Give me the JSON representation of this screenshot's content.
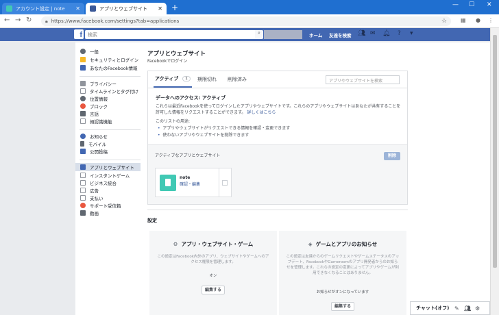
{
  "browser": {
    "tabs": [
      {
        "title": "アカウント設定 | note",
        "favicon_color": "#41c9b4"
      },
      {
        "title": "アプリとウェブサイト",
        "favicon_color": "#3b5998"
      }
    ],
    "new_tab": "+",
    "url": "https://www.facebook.com/settings?tab=applications"
  },
  "fb": {
    "search_placeholder": "検索",
    "links": {
      "home": "ホーム",
      "friends": "友達を検索"
    }
  },
  "sidebar": {
    "items": [
      {
        "label": "一般",
        "icon": "gear-icon",
        "color": "#606770"
      },
      {
        "label": "セキュリティとログイン",
        "icon": "shield-icon",
        "color": "#f7b928"
      },
      {
        "label": "あなたのFacebook情報",
        "icon": "facebook-icon",
        "color": "#4267b2"
      },
      {
        "label": "プライバシー",
        "icon": "lock-icon",
        "color": "#90949c"
      },
      {
        "label": "タイムラインとタグ付け",
        "icon": "timeline-icon",
        "color": "#90949c"
      },
      {
        "label": "位置情報",
        "icon": "location-icon",
        "color": "#606770"
      },
      {
        "label": "ブロック",
        "icon": "block-icon",
        "color": "#e9573f"
      },
      {
        "label": "言語",
        "icon": "language-icon",
        "color": "#606770"
      },
      {
        "label": "顔認識機能",
        "icon": "face-icon",
        "color": "#90949c"
      },
      {
        "label": "お知らせ",
        "icon": "globe-icon",
        "color": "#4267b2"
      },
      {
        "label": "モバイル",
        "icon": "mobile-icon",
        "color": "#606770"
      },
      {
        "label": "公開投稿",
        "icon": "rss-icon",
        "color": "#4267b2"
      },
      {
        "label": "アプリとウェブサイト",
        "icon": "apps-icon",
        "color": "#4267b2"
      },
      {
        "label": "インスタントゲーム",
        "icon": "game-icon",
        "color": "#90949c"
      },
      {
        "label": "ビジネス統合",
        "icon": "business-icon",
        "color": "#90949c"
      },
      {
        "label": "広告",
        "icon": "ads-icon",
        "color": "#90949c"
      },
      {
        "label": "支払い",
        "icon": "payment-icon",
        "color": "#90949c"
      },
      {
        "label": "サポート受信箱",
        "icon": "support-icon",
        "color": "#e9573f"
      },
      {
        "label": "動画",
        "icon": "video-icon",
        "color": "#606770"
      }
    ]
  },
  "main": {
    "title": "アプリとウェブサイト",
    "subtitle": "Facebookでログイン",
    "tabs": [
      {
        "label": "アクティブ",
        "count": "1"
      },
      {
        "label": "期限切れ"
      },
      {
        "label": "削除済み"
      }
    ],
    "search_placeholder": "アプリやウェブサイトを検索",
    "access_title": "データへのアクセス: アクティブ",
    "access_desc": "これらは最近Facebookを使ってログインしたアプリやウェブサイトです。これらのアプリやウェブサイトはあなたが共有することを許可した情報をリクエストすることができます。",
    "learn_more": "詳しくはこちら",
    "usage_title": "このリストの用途:",
    "usage_items": [
      "アプリやウェブサイトがリクエストできる情報を確認・変更できます",
      "使わないアプリやウェブサイトを削除できます"
    ],
    "active_header": "アクティブなアプリとウェブサイト",
    "delete_label": "削除",
    "app": {
      "name": "note",
      "links": "確認・編集"
    },
    "settings_title": "設定",
    "cards": [
      {
        "title": "アプリ・ウェブサイト・ゲーム",
        "desc": "この設定はFacebook内外のアプリ、ウェブサイトやゲームへのアクセス権限を管理します。",
        "status": "オン",
        "button": "編集する"
      },
      {
        "title": "ゲームとアプリのお知らせ",
        "desc": "この設定は友達からのゲームリクエストやゲームステータスのアップデート、FacebookやGameroomのアプリ開発者からのお知らせを管理します。これらの設定の変更によってアプリやゲームが利用できなくなることはありません。",
        "status": "お知らせがオンになっています",
        "button": "編集する"
      }
    ]
  },
  "chat": {
    "label": "チャット(オフ)"
  }
}
